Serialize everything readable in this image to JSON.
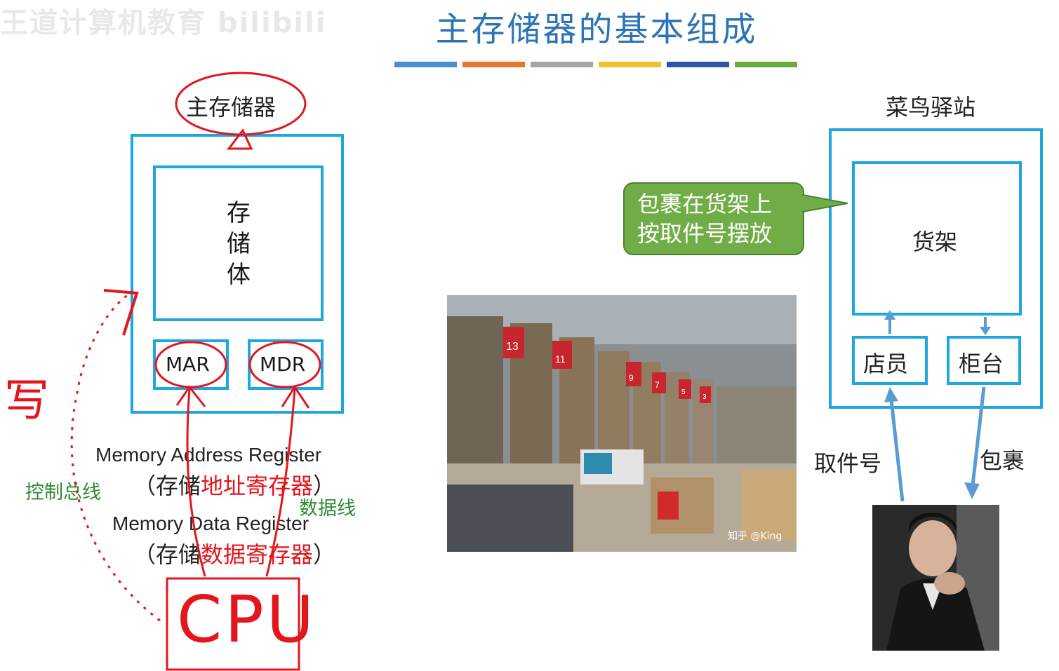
{
  "watermark": "王道计算机教育 bilibili",
  "title": "主存储器的基本组成",
  "title_color": "#2e74b5",
  "color_bar": [
    "#4a8fd4",
    "#e8762d",
    "#a5a5a5",
    "#f2c029",
    "#2f55a4",
    "#6aab3d"
  ],
  "main_memory": {
    "header": "主存储器",
    "storage_body": [
      "存",
      "储",
      "体"
    ],
    "mar": "MAR",
    "mdr": "MDR"
  },
  "descriptions": {
    "mar_en": "Memory Address Register",
    "mar_cn_prefix": "（存储",
    "mar_cn_red": "地址寄存器",
    "mar_cn_suffix": "）",
    "mdr_en": "Memory Data Register",
    "mdr_cn_prefix": "（存储",
    "mdr_cn_red": "数据寄存器",
    "mdr_cn_suffix": "）"
  },
  "annotations": {
    "control_bus": "控制总线",
    "data_bus": "数据线",
    "write_char": "写",
    "cpu": "CPU"
  },
  "analogy": {
    "station_title": "菜鸟驿站",
    "shelf": "货架",
    "clerk": "店员",
    "counter": "柜台",
    "callout_line1": "包裹在货架上",
    "callout_line2": "按取件号摆放",
    "pickup_number": "取件号",
    "package": "包裹"
  },
  "photo": {
    "watermark": "知乎 @King",
    "shelf_numbers": [
      "13",
      "11",
      "9",
      "7",
      "5",
      "3"
    ]
  },
  "colors": {
    "accent_blue": "#1ea6de",
    "annotation_red": "#e3151d",
    "green_text": "#2f8a2f",
    "callout_green": "#70ad47",
    "arrow_blue": "#5b9bd5"
  }
}
